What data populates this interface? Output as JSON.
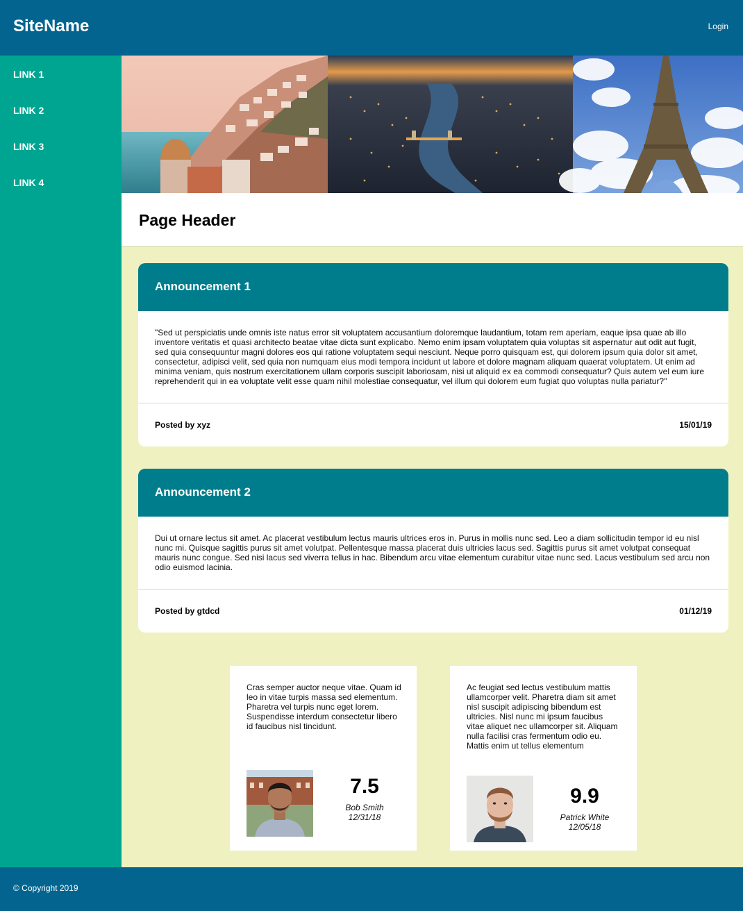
{
  "header": {
    "site_name": "SiteName",
    "login_label": "Login"
  },
  "sidebar": {
    "links": [
      "LINK 1",
      "LINK 2",
      "LINK 3",
      "LINK 4"
    ]
  },
  "page": {
    "title": "Page Header"
  },
  "announcements": [
    {
      "title": "Announcement 1",
      "body": "\"Sed ut perspiciatis unde omnis iste natus error sit voluptatem accusantium doloremque laudantium, totam rem aperiam, eaque ipsa quae ab illo inventore veritatis et quasi architecto beatae vitae dicta sunt explicabo. Nemo enim ipsam voluptatem quia voluptas sit aspernatur aut odit aut fugit, sed quia consequuntur magni dolores eos qui ratione voluptatem sequi nesciunt. Neque porro quisquam est, qui dolorem ipsum quia dolor sit amet, consectetur, adipisci velit, sed quia non numquam eius modi tempora incidunt ut labore et dolore magnam aliquam quaerat voluptatem. Ut enim ad minima veniam, quis nostrum exercitationem ullam corporis suscipit laboriosam, nisi ut aliquid ex ea commodi consequatur? Quis autem vel eum iure reprehenderit qui in ea voluptate velit esse quam nihil molestiae consequatur, vel illum qui dolorem eum fugiat quo voluptas nulla pariatur?\"",
      "author": "Posted by xyz",
      "date": "15/01/19"
    },
    {
      "title": "Announcement 2",
      "body": "Dui ut ornare lectus sit amet. Ac placerat vestibulum lectus mauris ultrices eros in. Purus in mollis nunc sed. Leo a diam sollicitudin tempor id eu nisl nunc mi. Quisque sagittis purus sit amet volutpat. Pellentesque massa placerat duis ultricies lacus sed. Sagittis purus sit amet volutpat consequat mauris nunc congue. Sed nisi lacus sed viverra tellus in hac. Bibendum arcu vitae elementum curabitur vitae nunc sed. Lacus vestibulum sed arcu non odio euismod lacinia.",
      "author": "Posted by gtdcd",
      "date": "01/12/19"
    }
  ],
  "reviews": [
    {
      "text": "Cras semper auctor neque vitae. Quam id leo in vitae turpis massa sed elementum. Pharetra vel turpis nunc eget lorem. Suspendisse interdum consectetur libero id faucibus nisl tincidunt.",
      "score": "7.5",
      "name": "Bob Smith",
      "date": "12/31/18"
    },
    {
      "text": "Ac feugiat sed lectus vestibulum mattis ullamcorper velit. Pharetra diam sit amet nisl suscipit adipiscing bibendum est ultricies. Nisl nunc mi ipsum faucibus vitae aliquet nec ullamcorper sit. Aliquam nulla facilisi cras fermentum odio eu. Mattis enim ut tellus elementum",
      "score": "9.9",
      "name": "Patrick White",
      "date": "12/05/18"
    }
  ],
  "footer": {
    "copyright": "© Copyright 2019"
  },
  "colors": {
    "topbar": "#03658f",
    "sidebar": "#00a591",
    "card_header": "#007d8c",
    "background": "#eff2c0"
  }
}
